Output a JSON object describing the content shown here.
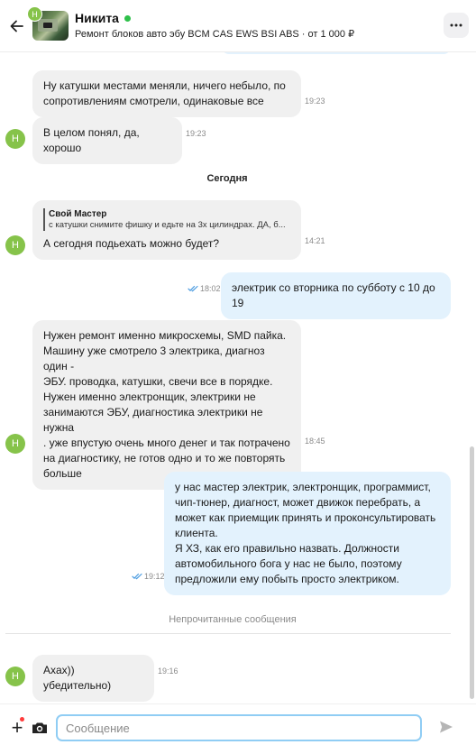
{
  "header": {
    "name": "Никита",
    "subtitle": "Ремонт блоков авто эбу BCM CAS EWS BSI ABS · от 1 000 ₽",
    "avatar_letter": "Н",
    "online_color": "#2ec04a"
  },
  "avatar_letter": "Н",
  "messages": [
    {
      "dir": "in",
      "lines": [
        "Ну катушки местами меняли, ничего небыло, по",
        "сопротивлениям смотрели, одинаковые все"
      ],
      "time": "19:23"
    },
    {
      "dir": "in",
      "lines": [
        "В целом понял, да, хорошо"
      ],
      "time": "19:23"
    },
    {
      "dir": "in",
      "quote_author": "Свой Мастер",
      "quote_text": "с катушки снимите фишку и едьте на 3х цилиндрах. ДА, б...",
      "lines": [
        "А сегодня подьехать можно будет?"
      ],
      "time": "14:21"
    },
    {
      "dir": "out",
      "lines": [
        "электрик со вторника по субботу с 10 до 19"
      ],
      "time": "18:02"
    },
    {
      "dir": "in",
      "lines": [
        "Нужен ремонт именно микросхемы, SMD пайка.",
        "Машину уже смотрело 3 электрика, диагноз один -",
        "ЭБУ. проводка, катушки, свечи все в порядке.",
        "Нужен именно электронщик, электрики не",
        "занимаются ЭБУ, диагностика электрики не нужна",
        ". уже впустую очень много денег и так потрачено",
        "на диагностику, не готов одно и то же повторять",
        "больше"
      ],
      "time": "18:45"
    },
    {
      "dir": "out",
      "lines": [
        "у нас мастер электрик, электронщик, программист,",
        "чип-тюнер, диагност, может движок перебрать, а",
        "может как приемщик принять и проконсультировать",
        "клиента.",
        "Я ХЗ, как его правильно назвать. Должности",
        "автомобильного бога у нас не было, поэтому",
        "предложили ему побыть просто электриком."
      ],
      "time": "19:12"
    },
    {
      "dir": "in",
      "lines": [
        "Axax)) убедительно)"
      ],
      "time": "19:16"
    }
  ],
  "date_separator": "Сегодня",
  "unread_separator": "Непрочитанные сообщения",
  "composer": {
    "placeholder": "Сообщение"
  },
  "colors": {
    "incoming_bubble": "#f0f0f0",
    "outgoing_bubble": "#e3f2fd",
    "avatar": "#86c34a",
    "accent": "#90cdf4",
    "read_check": "#4a9be0"
  },
  "icons": [
    "back-arrow-icon",
    "more-icon",
    "plus-icon",
    "camera-icon",
    "send-icon",
    "double-check-icon"
  ]
}
